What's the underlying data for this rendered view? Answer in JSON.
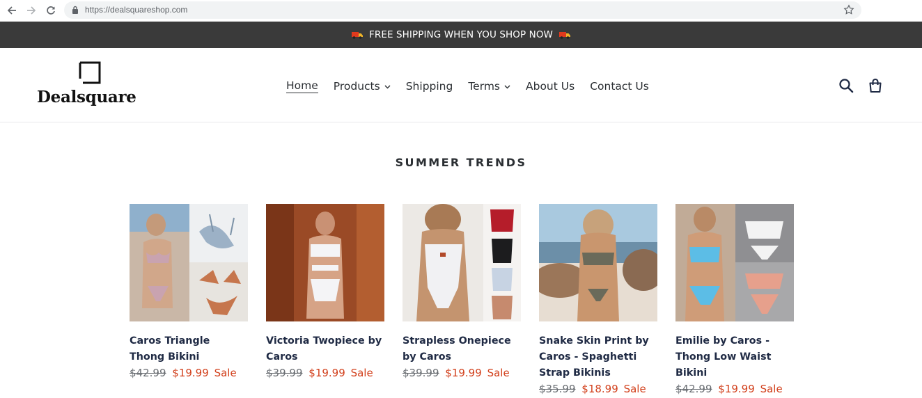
{
  "browser": {
    "url": "https://dealsquareshop.com",
    "icons": [
      "back-arrow-icon",
      "forward-arrow-icon",
      "reload-icon",
      "lock-icon",
      "star-icon"
    ]
  },
  "announcement": {
    "text": "FREE SHIPPING WHEN YOU SHOP NOW",
    "icon": "truck-icon"
  },
  "header": {
    "logo_text": "Dealsquare",
    "nav": [
      {
        "label": "Home",
        "active": true,
        "has_dropdown": false
      },
      {
        "label": "Products",
        "active": false,
        "has_dropdown": true
      },
      {
        "label": "Shipping",
        "active": false,
        "has_dropdown": false
      },
      {
        "label": "Terms",
        "active": false,
        "has_dropdown": true
      },
      {
        "label": "About Us",
        "active": false,
        "has_dropdown": false
      },
      {
        "label": "Contact Us",
        "active": false,
        "has_dropdown": false
      }
    ],
    "icons": [
      "search-icon",
      "cart-icon"
    ]
  },
  "collection": {
    "title": "SUMMER TRENDS",
    "products": [
      {
        "title": "Caros Triangle Thong Bikini",
        "compare_price": "$42.99",
        "price": "$19.99",
        "sale_label": "Sale"
      },
      {
        "title": "Victoria Twopiece by Caros",
        "compare_price": "$39.99",
        "price": "$19.99",
        "sale_label": "Sale"
      },
      {
        "title": "Strapless Onepiece by Caros",
        "compare_price": "$39.99",
        "price": "$19.99",
        "sale_label": "Sale"
      },
      {
        "title": "Snake Skin Print by Caros - Spaghetti Strap Bikinis",
        "compare_price": "$35.99",
        "price": "$18.99",
        "sale_label": "Sale"
      },
      {
        "title": "Emilie by Caros - Thong Low Waist Bikini",
        "compare_price": "$42.99",
        "price": "$19.99",
        "sale_label": "Sale"
      }
    ]
  },
  "colors": {
    "announcement_bg": "#3a3a3a",
    "sale_red": "#d2401c",
    "title_navy": "#1f2a44"
  }
}
